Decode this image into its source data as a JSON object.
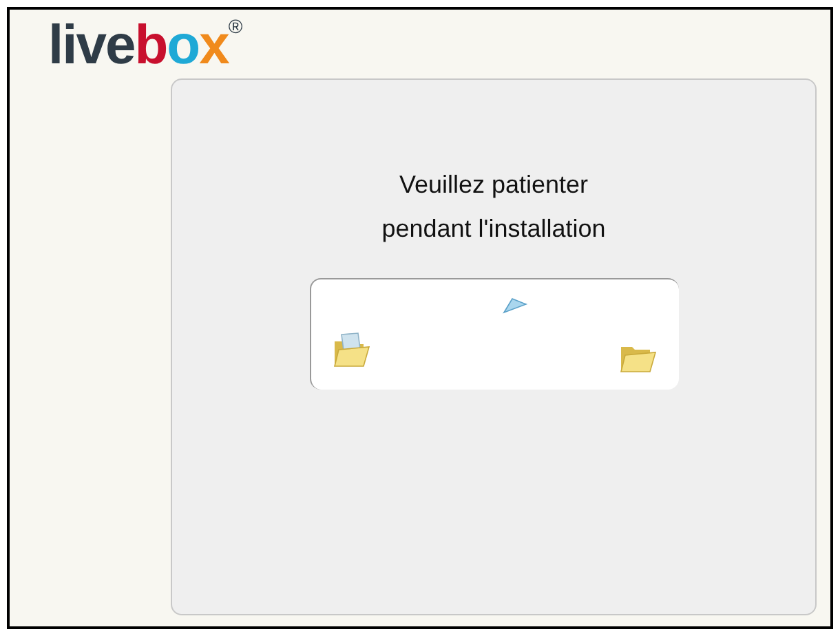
{
  "logo": {
    "parts": [
      {
        "text": "live",
        "color": "#2f3c47"
      },
      {
        "text": "b",
        "color": "#c8102e"
      },
      {
        "text": "o",
        "color": "#1fa9d6"
      },
      {
        "text": "x",
        "color": "#f08a1c"
      }
    ],
    "mark": "®"
  },
  "message": {
    "lines": [
      "Veuillez patienter",
      "pendant l'installation"
    ]
  }
}
